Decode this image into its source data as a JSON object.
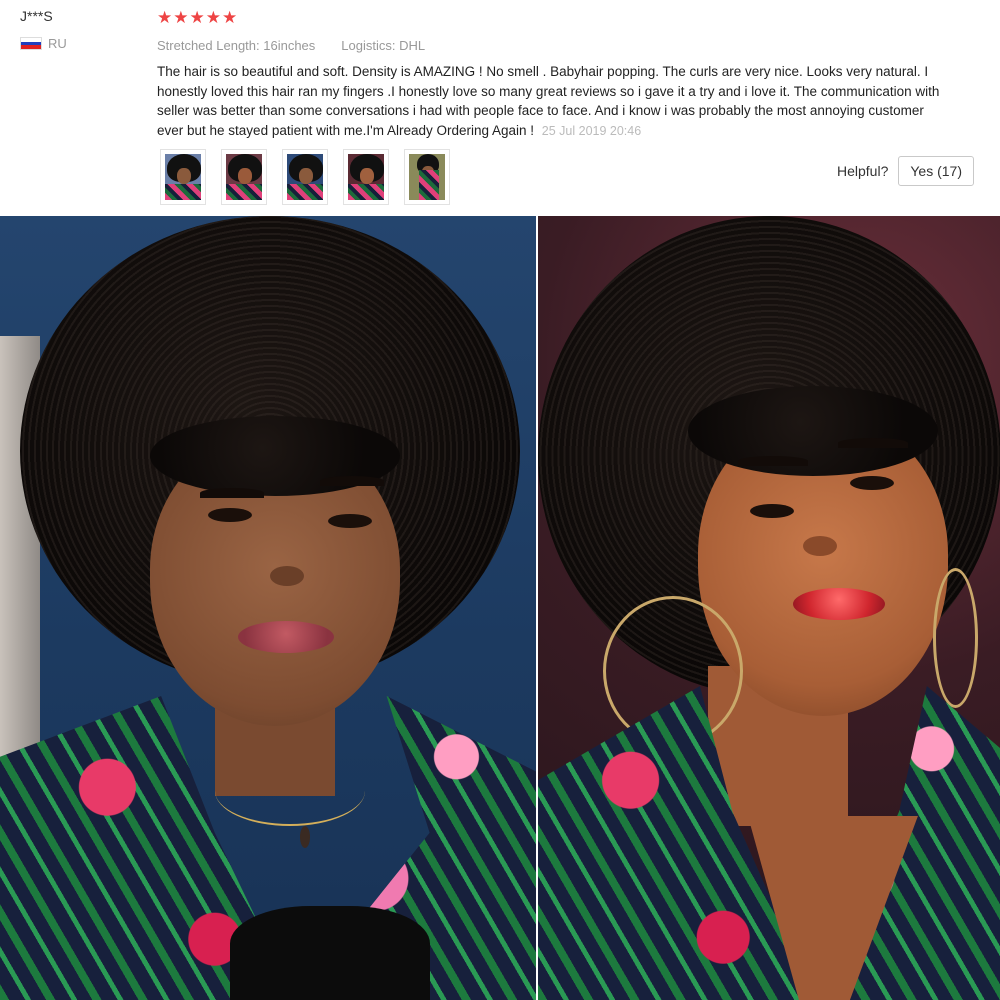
{
  "review": {
    "reviewer_name": "J***S",
    "country_code": "RU",
    "flag_colors": [
      "#ffffff",
      "#1f3fbf",
      "#e02020"
    ],
    "rating": 5,
    "stars": [
      "★",
      "★",
      "★",
      "★",
      "★"
    ],
    "star_color": "#ee4444",
    "attributes": [
      "Stretched Length: 16inches",
      "Logistics: DHL"
    ],
    "text": "The hair is so beautiful and soft. Density is AMAZING ! No smell . Babyhair popping. The curls are very nice. Looks very natural. I honestly loved this hair ran my fingers .I honestly love so many great reviews so i gave it a try and i love it. The communication with seller was better than some conversations i had with people face to face. And i know i was probably the most annoying customer ever but he stayed patient with me.I'm Already Ordering Again !",
    "date": "25 Jul 2019 20:46",
    "thumbnail_count": 5,
    "helpful_label": "Helpful?",
    "yes_button_label": "Yes (17)"
  }
}
